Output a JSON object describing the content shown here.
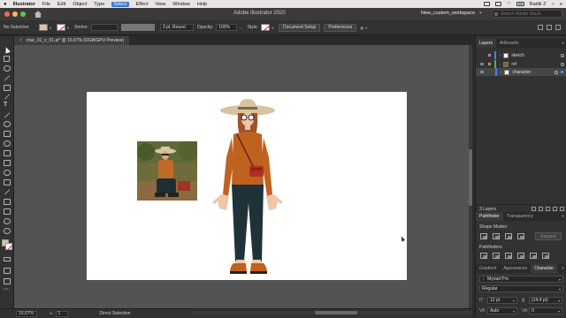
{
  "menubar": {
    "apple": "",
    "app": "Illustrator",
    "items": [
      "File",
      "Edit",
      "Object",
      "Type",
      "Select",
      "Effect",
      "View",
      "Window",
      "Help"
    ],
    "active_item": "Select",
    "user": "Radik Z"
  },
  "header": {
    "title": "Adobe Illustrator 2020",
    "workspace": "New_custom_workspace",
    "search_placeholder": "Search Adobe Stock"
  },
  "controlbar": {
    "selection": "No Selection",
    "stroke_label": "Stroke:",
    "stroke_value": "",
    "stroke_style": "3 pt. Round",
    "opacity_label": "Opacity:",
    "opacity_value": "100%",
    "style_label": "Style:",
    "document_setup": "Document Setup",
    "preferences": "Preferences",
    "fill_color": "#d6c3a3"
  },
  "document": {
    "tab_title": "char_01_v_01.ai* @ 16,67% (RGB/GPU Preview)",
    "close": "×"
  },
  "statusbar": {
    "zoom": "16,67%",
    "page": "1",
    "tool_status": "Direct Selection"
  },
  "layers_panel": {
    "tabs": [
      "Layers",
      "Artboards"
    ],
    "layers": [
      {
        "name": "sketch",
        "color": "#4a7bff",
        "visible": false,
        "locked": true
      },
      {
        "name": "ref",
        "color": "#3fbf3f",
        "visible": true,
        "locked": true
      },
      {
        "name": "character",
        "color": "#4a7bff",
        "visible": true,
        "locked": false,
        "selected": true
      }
    ],
    "count": "3 Layers"
  },
  "pathfinder_panel": {
    "tabs": [
      "Pathfinder",
      "Transparency"
    ],
    "shape_modes": "Shape Modes:",
    "pathfinders": "Pathfinders:",
    "expand": "Expand"
  },
  "character_panel": {
    "tabs": [
      "Gradient",
      "Appearance",
      "Character"
    ],
    "font": "Myriad Pro",
    "style": "Regular",
    "size": "12 pt",
    "leading": "(14,4 pt)",
    "kerning": "Auto",
    "tracking": "0"
  }
}
